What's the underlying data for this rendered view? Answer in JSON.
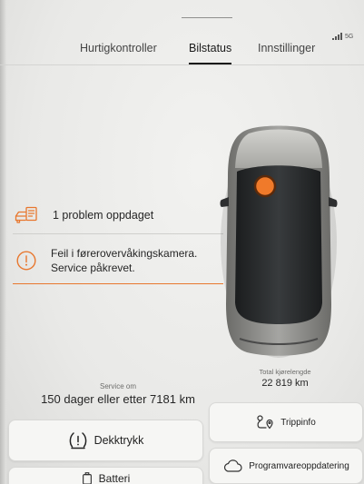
{
  "status_bar": {
    "network_label": "5G",
    "signal_icon": "signal-bars-icon"
  },
  "tabs": [
    {
      "label": "Hurtigkontroller",
      "active": false
    },
    {
      "label": "Bilstatus",
      "active": true
    },
    {
      "label": "Innstillinger",
      "active": false
    }
  ],
  "problems": {
    "summary_icon": "car-service-icon",
    "summary": "1 problem oppdaget",
    "items": [
      {
        "icon": "warning-circle-icon",
        "lines": [
          "Feil i førerovervåkingskamera.",
          "Service påkrevet."
        ]
      }
    ]
  },
  "car": {
    "image": "car-top-view",
    "marker": "camera-location-marker"
  },
  "service": {
    "label": "Service om",
    "value": "150 dager eller etter 7181 km"
  },
  "odometer": {
    "label": "Total kjørelengde",
    "value": "22 819 km"
  },
  "actions": [
    {
      "label": "Dekktrykk",
      "icon": "tire-pressure-icon"
    },
    {
      "label": "Trippinfo",
      "icon": "trip-route-icon"
    },
    {
      "label": "Batteri",
      "icon": "battery-icon"
    },
    {
      "label": "Programvareoppdatering",
      "icon": "cloud-icon"
    }
  ],
  "colors": {
    "accent": "#e8772e",
    "marker": "#f07a2a",
    "background": "#ebebe9",
    "card": "#f6f6f4",
    "text": "#262626"
  }
}
